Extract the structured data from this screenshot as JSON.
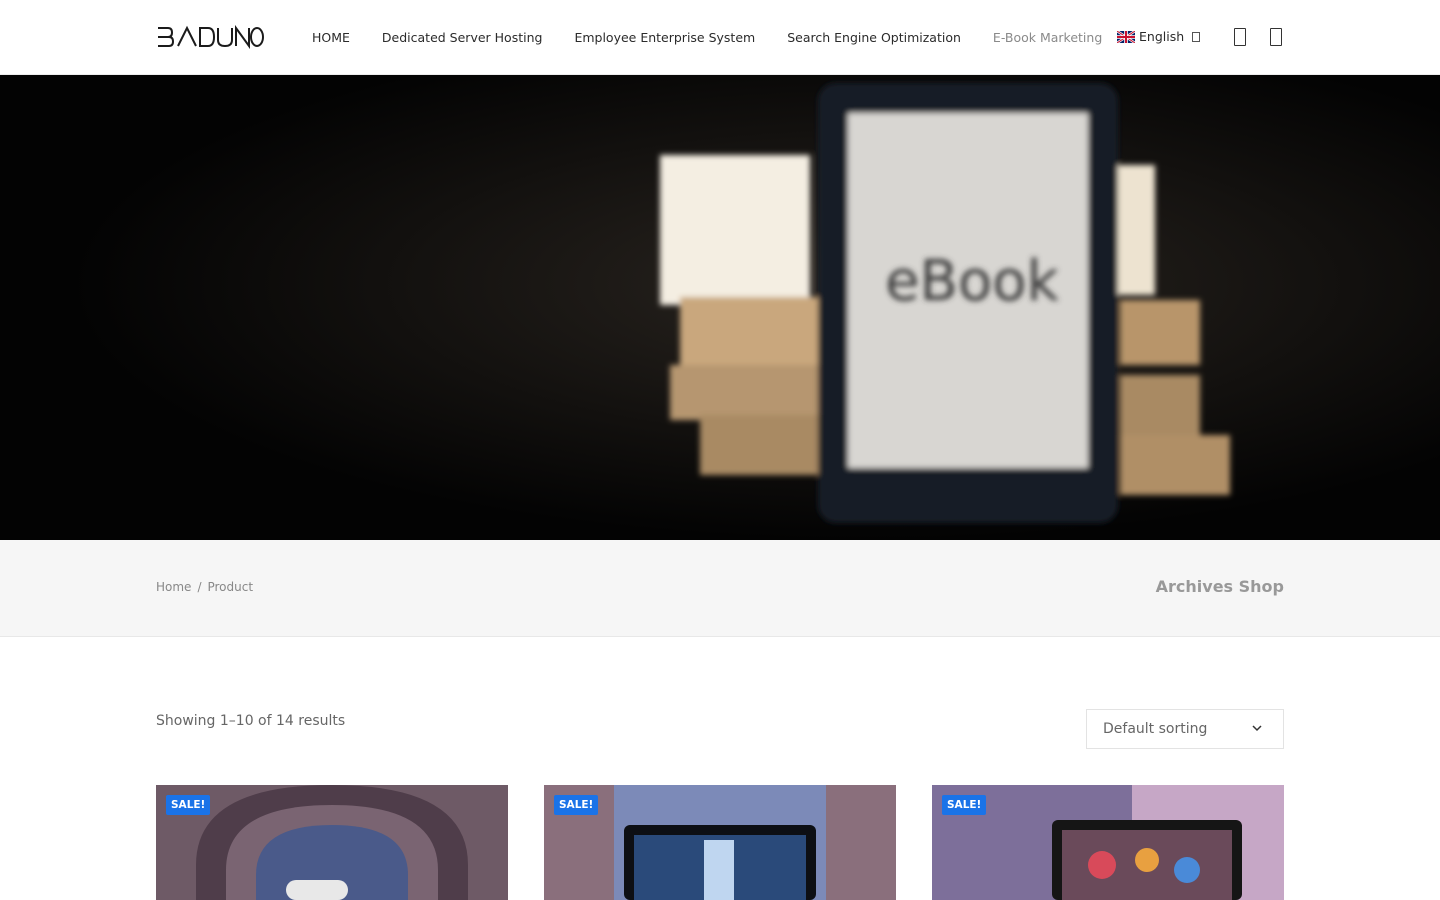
{
  "header": {
    "logo_text": "BADUNO",
    "nav": [
      {
        "label": "HOME",
        "active": false
      },
      {
        "label": "Dedicated Server Hosting",
        "active": false
      },
      {
        "label": "Employee Enterprise System",
        "active": false
      },
      {
        "label": "Search Engine Optimization",
        "active": false
      },
      {
        "label": "E-Book Marketing",
        "active": true
      }
    ],
    "language": {
      "label": "English",
      "flag": "uk-flag-icon"
    },
    "icons": [
      "search-icon",
      "cart-icon"
    ]
  },
  "hero": {
    "image_text": "eBook"
  },
  "breadcrumb": {
    "items": [
      "Home",
      "Product"
    ],
    "separator": "/",
    "title": "Archives Shop"
  },
  "shop": {
    "results_text": "Showing 1–10 of 14 results",
    "sorting": {
      "selected": "Default sorting"
    },
    "products": [
      {
        "badge": "SALE!"
      },
      {
        "badge": "SALE!"
      },
      {
        "badge": "SALE!"
      }
    ]
  },
  "colors": {
    "accent": "#1a73e8",
    "nav_active": "#8a8a8a"
  }
}
